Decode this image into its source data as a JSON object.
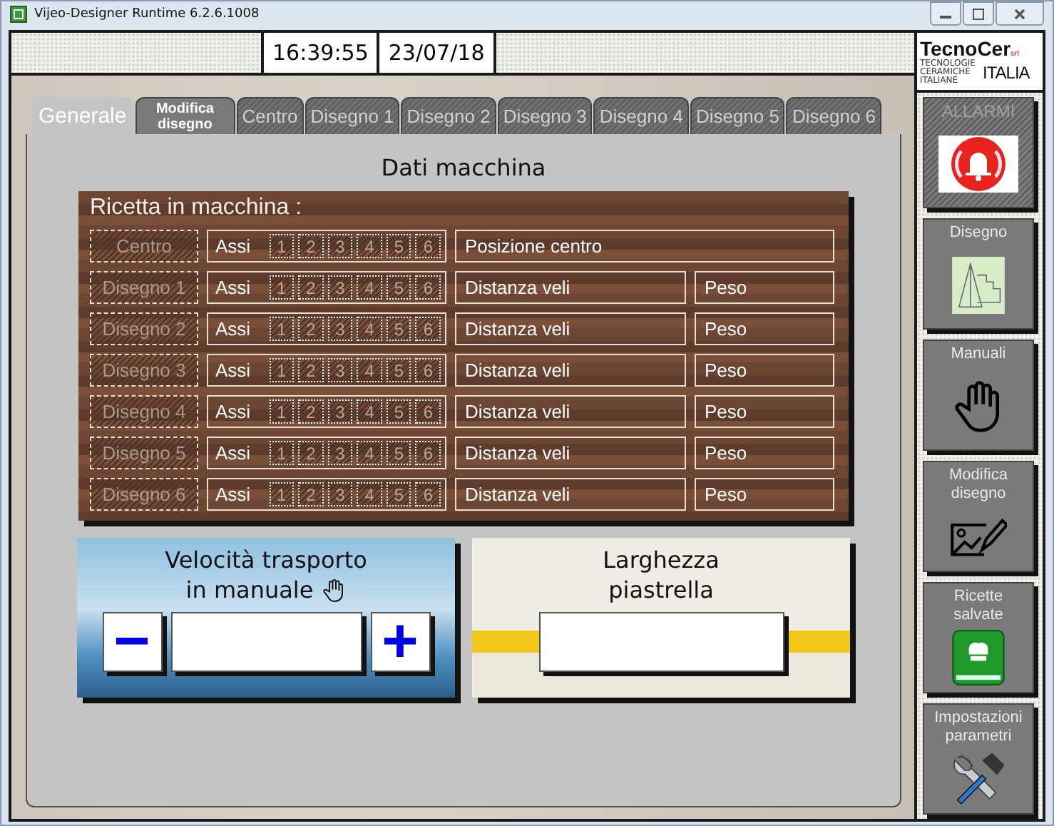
{
  "window": {
    "title": "Vijeo-Designer Runtime 6.2.6.1008"
  },
  "header": {
    "time": "16:39:55",
    "date": "23/07/18"
  },
  "logo": {
    "name": "TecnoCer",
    "suffix": "srl",
    "tagline": "TECNOLOGIE CERAMICHE ITALIANE",
    "country": "ITALIA"
  },
  "tabs": [
    {
      "label": "Generale",
      "selected": true,
      "disabled": false
    },
    {
      "label": "Modifica disegno",
      "selected": false,
      "disabled": false
    },
    {
      "label": "Centro",
      "selected": false,
      "disabled": true
    },
    {
      "label": "Disegno 1",
      "selected": false,
      "disabled": true
    },
    {
      "label": "Disegno 2",
      "selected": false,
      "disabled": true
    },
    {
      "label": "Disegno 3",
      "selected": false,
      "disabled": true
    },
    {
      "label": "Disegno 4",
      "selected": false,
      "disabled": true
    },
    {
      "label": "Disegno 5",
      "selected": false,
      "disabled": true
    },
    {
      "label": "Disegno 6",
      "selected": false,
      "disabled": true
    }
  ],
  "section_title": "Dati macchina",
  "recipe": {
    "title": "Ricetta in macchina :",
    "rows": [
      {
        "label": "Centro",
        "disabled": true,
        "axes_label": "Assi",
        "axes": [
          {
            "label": "1",
            "disabled": true
          },
          {
            "label": "2",
            "disabled": true
          },
          {
            "label": "3",
            "disabled": true
          },
          {
            "label": "4",
            "disabled": true
          },
          {
            "label": "5",
            "disabled": true
          },
          {
            "label": "6",
            "disabled": true
          }
        ],
        "field": "Posizione centro"
      },
      {
        "label": "Disegno 1",
        "disabled": true,
        "axes_label": "Assi",
        "axes": [
          {
            "label": "1",
            "disabled": true
          },
          {
            "label": "2",
            "disabled": true
          },
          {
            "label": "3",
            "disabled": true
          },
          {
            "label": "4",
            "disabled": true
          },
          {
            "label": "5",
            "disabled": true
          },
          {
            "label": "6",
            "disabled": true
          }
        ],
        "field": "Distanza veli",
        "weight": "Peso"
      },
      {
        "label": "Disegno 2",
        "disabled": true,
        "axes_label": "Assi",
        "axes": [
          {
            "label": "1",
            "disabled": true
          },
          {
            "label": "2",
            "disabled": true
          },
          {
            "label": "3",
            "disabled": true
          },
          {
            "label": "4",
            "disabled": true
          },
          {
            "label": "5",
            "disabled": true
          },
          {
            "label": "6",
            "disabled": true
          }
        ],
        "field": "Distanza veli",
        "weight": "Peso"
      },
      {
        "label": "Disegno 3",
        "disabled": true,
        "axes_label": "Assi",
        "axes": [
          {
            "label": "1",
            "disabled": true
          },
          {
            "label": "2",
            "disabled": true
          },
          {
            "label": "3",
            "disabled": true
          },
          {
            "label": "4",
            "disabled": true
          },
          {
            "label": "5",
            "disabled": true
          },
          {
            "label": "6",
            "disabled": true
          }
        ],
        "field": "Distanza veli",
        "weight": "Peso"
      },
      {
        "label": "Disegno 4",
        "disabled": true,
        "axes_label": "Assi",
        "axes": [
          {
            "label": "1",
            "disabled": true
          },
          {
            "label": "2",
            "disabled": true
          },
          {
            "label": "3",
            "disabled": true
          },
          {
            "label": "4",
            "disabled": true
          },
          {
            "label": "5",
            "disabled": true
          },
          {
            "label": "6",
            "disabled": true
          }
        ],
        "field": "Distanza veli",
        "weight": "Peso"
      },
      {
        "label": "Disegno 5",
        "disabled": true,
        "axes_label": "Assi",
        "axes": [
          {
            "label": "1",
            "disabled": true
          },
          {
            "label": "2",
            "disabled": true
          },
          {
            "label": "3",
            "disabled": true
          },
          {
            "label": "4",
            "disabled": true
          },
          {
            "label": "5",
            "disabled": true
          },
          {
            "label": "6",
            "disabled": true
          }
        ],
        "field": "Distanza veli",
        "weight": "Peso"
      },
      {
        "label": "Disegno 6",
        "disabled": true,
        "axes_label": "Assi",
        "axes": [
          {
            "label": "1",
            "disabled": true
          },
          {
            "label": "2",
            "disabled": true
          },
          {
            "label": "3",
            "disabled": true
          },
          {
            "label": "4",
            "disabled": true
          },
          {
            "label": "5",
            "disabled": true
          },
          {
            "label": "6",
            "disabled": true
          }
        ],
        "field": "Distanza veli",
        "weight": "Peso"
      }
    ]
  },
  "speed": {
    "title": "Velocità trasporto",
    "subtitle": "in manuale",
    "minus": "−",
    "plus": "+"
  },
  "width": {
    "title": "Larghezza piastrella"
  },
  "sidebar": [
    {
      "label": "ALLARMI",
      "kind": "bell",
      "disabled": true
    },
    {
      "label": "Disegno",
      "kind": "drawing",
      "disabled": false
    },
    {
      "label": "Manuali",
      "kind": "hand",
      "disabled": false
    },
    {
      "label": "Modifica disegno",
      "kind": "edit",
      "disabled": false
    },
    {
      "label": "Ricette salvate",
      "kind": "book",
      "disabled": false
    },
    {
      "label": "Impostazioni parametri",
      "kind": "tools",
      "disabled": false
    }
  ]
}
